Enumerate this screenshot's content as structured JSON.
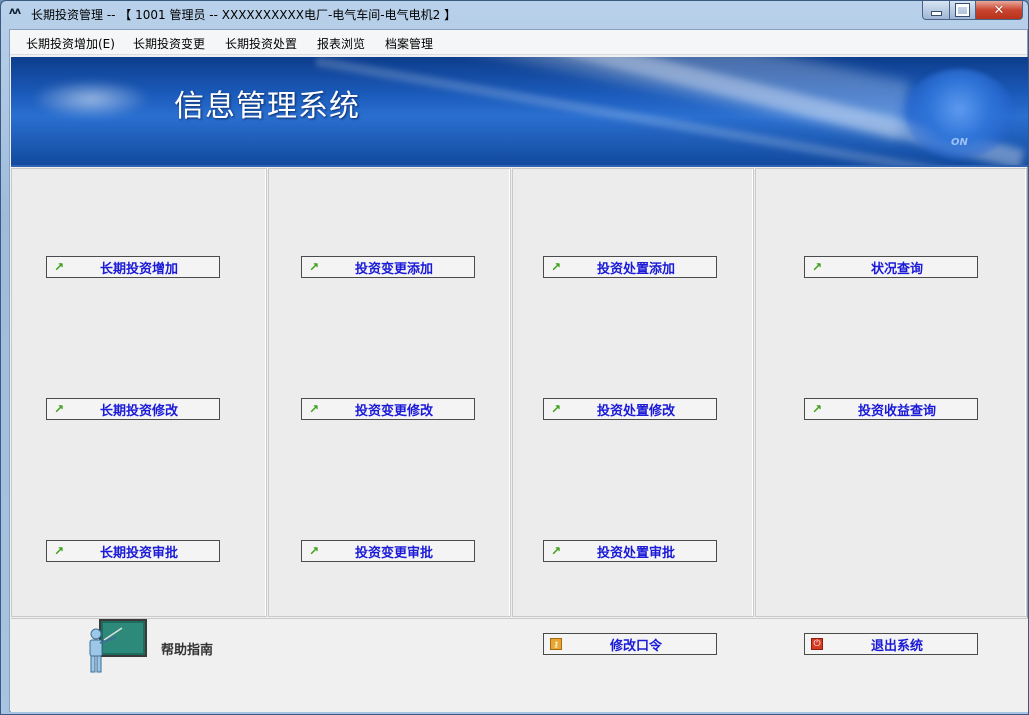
{
  "window": {
    "title": "长期投资管理 -- 【 1001 管理员 -- XXXXXXXXXX电厂-电气车间-电气电机2 】",
    "icon": "app-logo-icon"
  },
  "menu": [
    "长期投资增加(E)",
    "长期投资变更",
    "长期投资处置",
    "报表浏览",
    "档案管理"
  ],
  "banner": {
    "title": "信息管理系统"
  },
  "columns": [
    {
      "buttons": [
        "长期投资增加",
        "长期投资修改",
        "长期投资审批"
      ]
    },
    {
      "buttons": [
        "投资变更添加",
        "投资变更修改",
        "投资变更审批"
      ]
    },
    {
      "buttons": [
        "投资处置添加",
        "投资处置修改",
        "投资处置审批"
      ]
    },
    {
      "buttons": [
        "状况查询",
        "投资收益查询"
      ]
    }
  ],
  "bottom": {
    "help_label": "帮助指南",
    "change_password": "修改口令",
    "exit": "退出系统"
  },
  "colors": {
    "button_text": "#1a1ad8",
    "arrow_icon": "#3aa018",
    "banner": "#1b5bbb"
  }
}
